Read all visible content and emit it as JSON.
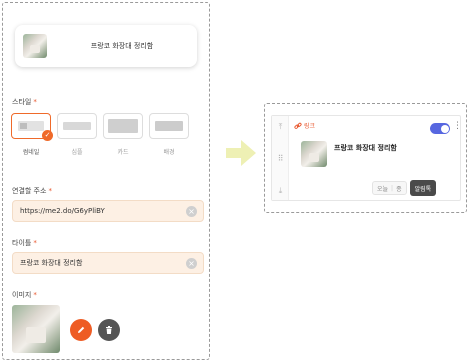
{
  "editor": {
    "preview_title": "프랑코 화장대 정리함",
    "style_section": {
      "label": "스타일",
      "required_mark": "*",
      "options": [
        {
          "label": "썸네일",
          "selected": true
        },
        {
          "label": "심플",
          "selected": false
        },
        {
          "label": "카드",
          "selected": false
        },
        {
          "label": "배경",
          "selected": false
        }
      ]
    },
    "url_section": {
      "label": "연결할 주소",
      "required_mark": "*",
      "value": "https://me2.do/G6yPliBY"
    },
    "title_section": {
      "label": "타이틀",
      "required_mark": "*",
      "value": "프랑코 화장대 정리함"
    },
    "image_section": {
      "label": "이미지",
      "required_mark": "*"
    }
  },
  "block_preview": {
    "type_label": "링크",
    "title": "프랑코 화장대 정리함",
    "toggle_on": true,
    "date_chip": {
      "left": "오늘",
      "right": "종"
    },
    "settings_label": "알림톡"
  },
  "colors": {
    "accent": "#ef6a2a",
    "toggle": "#5767e0",
    "field_bg": "#fdf0e4",
    "arrow": "#eef0b4"
  }
}
